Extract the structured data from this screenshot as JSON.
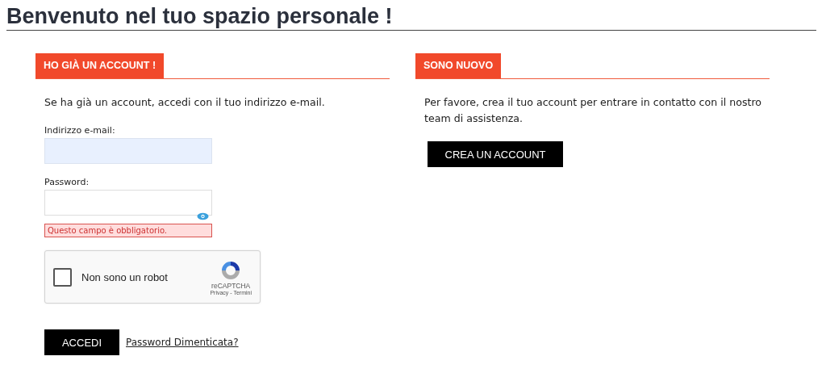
{
  "page_title": "Benvenuto nel tuo spazio personale !",
  "login": {
    "heading": "HO GIÀ UN ACCOUNT !",
    "intro": "Se ha già un account, accedi con il tuo indirizzo e-mail.",
    "fields": [
      {
        "label": "Indirizzo e-mail:",
        "kind": "email",
        "autofilled": true
      },
      {
        "label": "Password:",
        "kind": "password",
        "autofilled": false,
        "error": "Questo campo è obbligatorio."
      }
    ],
    "captcha": {
      "label": "Non sono un robot",
      "checked": false,
      "brand": "reCAPTCHA",
      "links": "Privacy - Termini"
    },
    "submit": "ACCEDI",
    "forgot_link": "Password Dimenticata?"
  },
  "register": {
    "heading": "SONO NUOVO",
    "intro": "Per favore, crea il tuo account per entrare in contatto con il nostro team di assistenza.",
    "button": "CREA UN ACCOUNT"
  }
}
